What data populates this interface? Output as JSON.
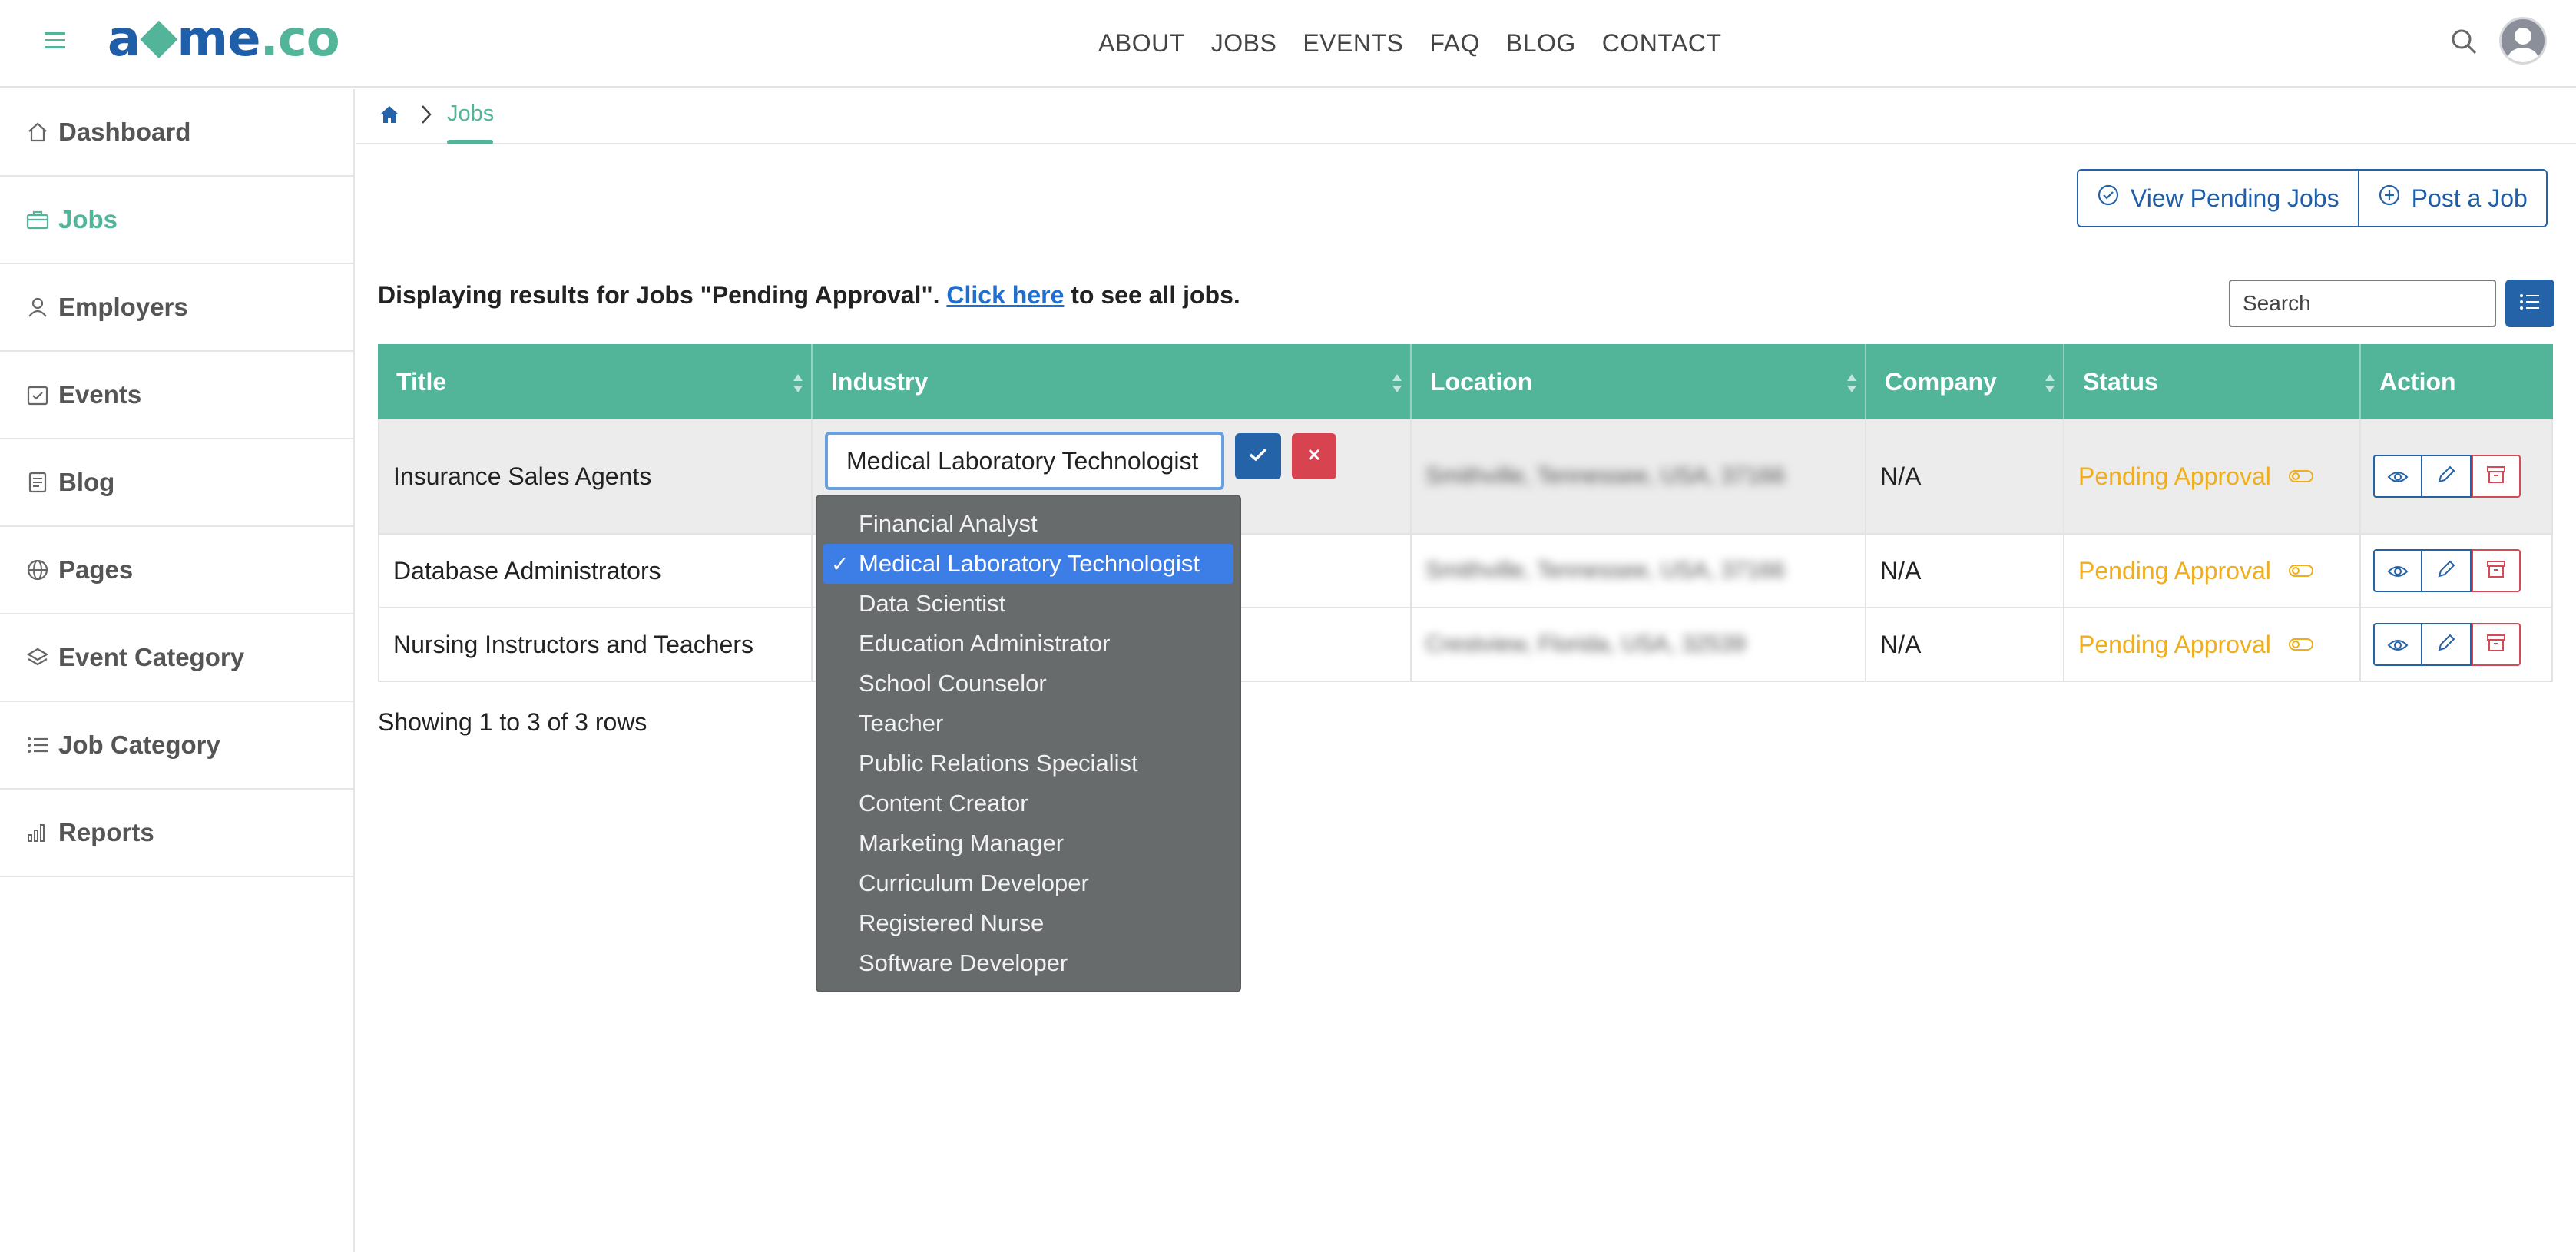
{
  "brand": {
    "logo_main": "a",
    "logo_mark": "◆",
    "logo_rest": "me",
    "logo_dot": ".co"
  },
  "nav": [
    "ABOUT",
    "JOBS",
    "EVENTS",
    "FAQ",
    "BLOG",
    "CONTACT"
  ],
  "sidebar": {
    "items": [
      {
        "label": "Dashboard",
        "icon": "home-icon"
      },
      {
        "label": "Jobs",
        "icon": "briefcase-icon",
        "active": true
      },
      {
        "label": "Employers",
        "icon": "user-icon"
      },
      {
        "label": "Events",
        "icon": "calendar-check-icon"
      },
      {
        "label": "Blog",
        "icon": "document-icon"
      },
      {
        "label": "Pages",
        "icon": "globe-icon"
      },
      {
        "label": "Event Category",
        "icon": "layers-icon"
      },
      {
        "label": "Job Category",
        "icon": "list-icon"
      },
      {
        "label": "Reports",
        "icon": "bar-chart-icon"
      }
    ]
  },
  "breadcrumb": {
    "current": "Jobs"
  },
  "toolbar": {
    "view_pending_label": "View Pending Jobs",
    "post_job_label": "Post a Job"
  },
  "result": {
    "prefix": "Displaying results for Jobs \"Pending Approval\". ",
    "link": "Click here",
    "suffix": " to see all jobs."
  },
  "search": {
    "placeholder": "Search"
  },
  "table": {
    "columns": [
      "Title",
      "Industry",
      "Location",
      "Company",
      "Status",
      "Action"
    ],
    "rows": [
      {
        "title": "Insurance Sales Agents",
        "industry": "",
        "location": "Smithville, Tennessee, USA, 37166",
        "company": "N/A",
        "status": "Pending Approval"
      },
      {
        "title": "Database Administrators",
        "industry": "",
        "location": "Smithville, Tennessee, USA, 37166",
        "company": "N/A",
        "status": "Pending Approval"
      },
      {
        "title": "Nursing Instructors and Teachers",
        "industry": "",
        "location": "Crestview, Florida, USA, 32539",
        "company": "N/A",
        "status": "Pending Approval"
      }
    ],
    "footer": "Showing 1 to 3 of 3 rows"
  },
  "editor": {
    "value": "Medical Laboratory Technologist",
    "options": [
      "Financial Analyst",
      "Medical Laboratory Technologist",
      "Data Scientist",
      "Education Administrator",
      "School Counselor",
      "Teacher",
      "Public Relations Specialist",
      "Content Creator",
      "Marketing Manager",
      "Curriculum Developer",
      "Registered Nurse",
      "Software Developer"
    ],
    "selected_index": 1,
    "check_glyph": "✓"
  },
  "colors": {
    "accent": "#52b59a",
    "primary": "#2563a8",
    "danger": "#d7434f",
    "pending": "#f0ad1c"
  }
}
